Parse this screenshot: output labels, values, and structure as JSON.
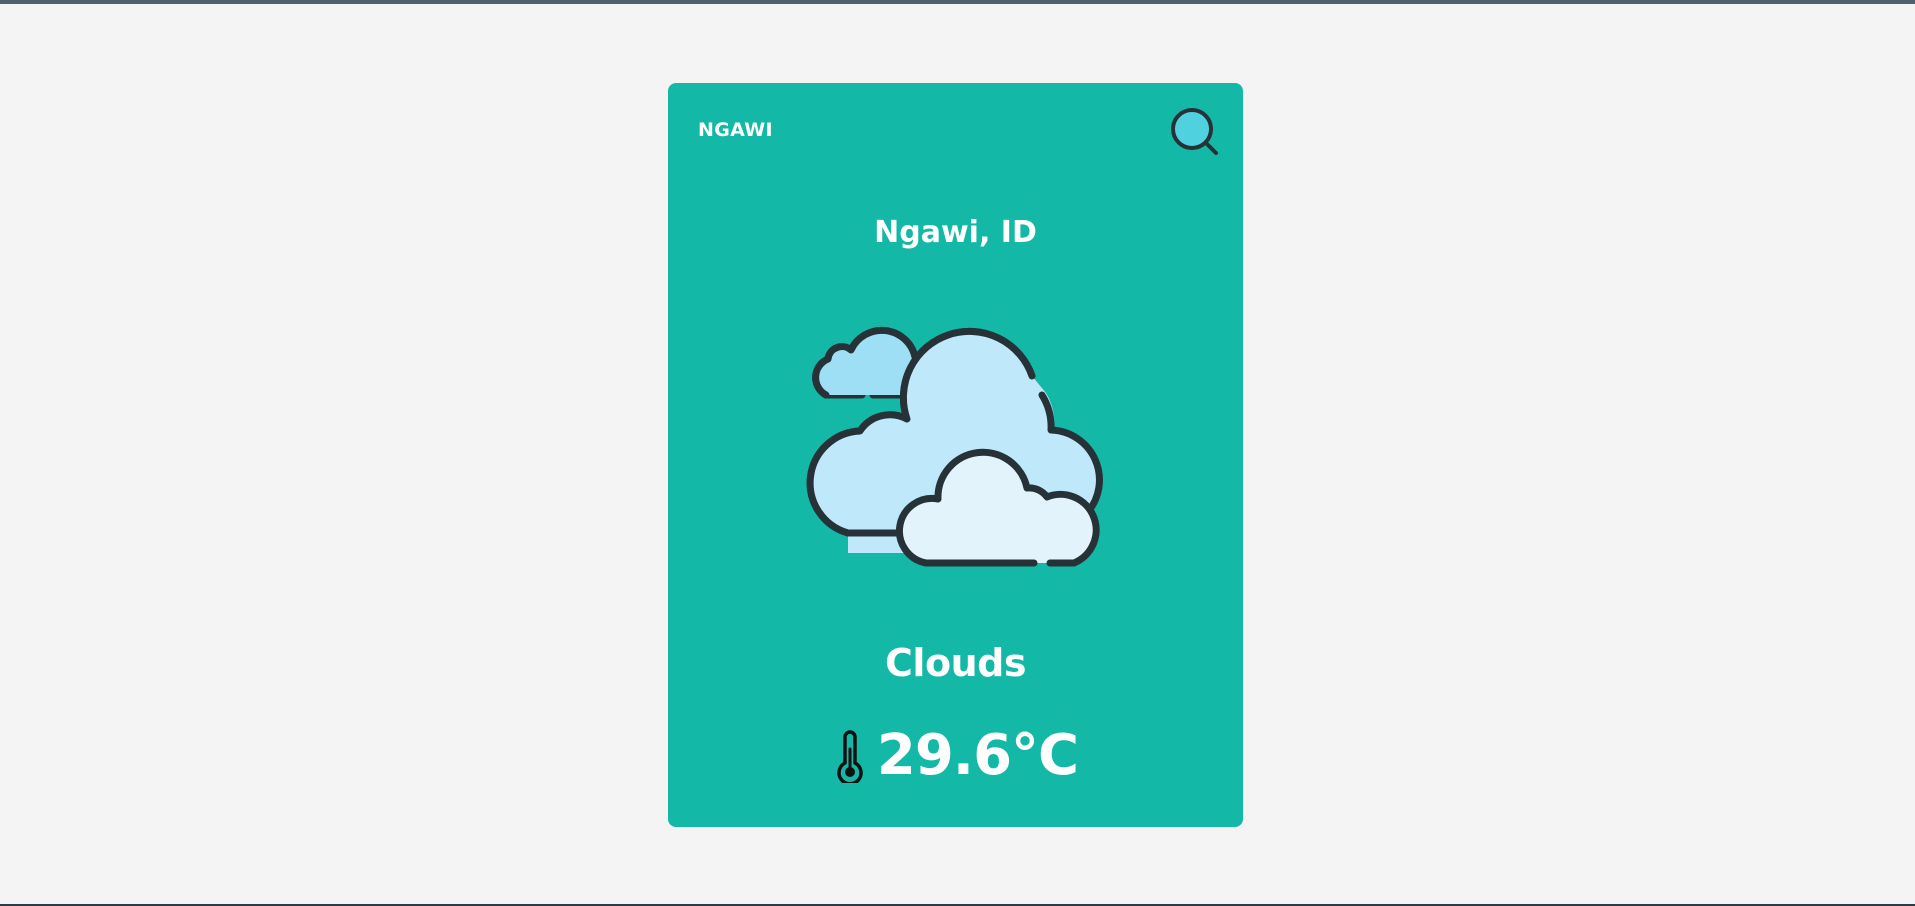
{
  "header": {
    "city_code": "NGAWI",
    "search_icon": "search-icon"
  },
  "weather": {
    "location": "Ngawi, ID",
    "icon": "clouds-icon",
    "condition": "Clouds",
    "temperature_icon": "thermometer-icon",
    "temperature": "29.6°C"
  },
  "colors": {
    "background": "#f4f4f4",
    "card": "#14b8a6",
    "text": "#ffffff",
    "search_icon_fill": "#4fd1e0",
    "outline": "#263238"
  }
}
